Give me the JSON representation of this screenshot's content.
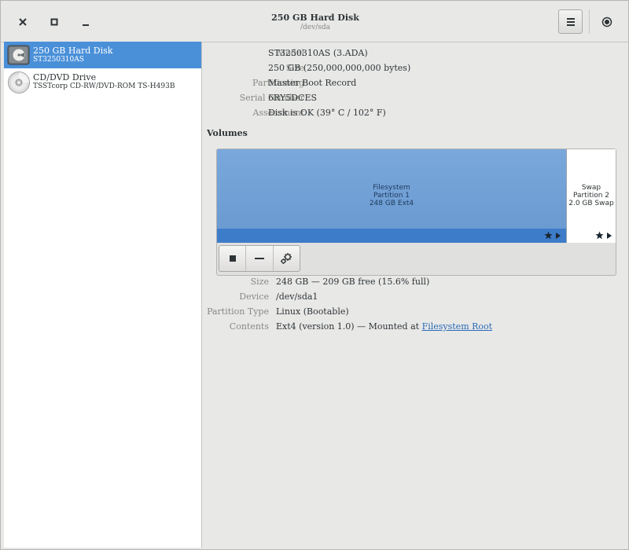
{
  "header": {
    "title": "250 GB Hard Disk",
    "subtitle": "/dev/sda",
    "close_icon": "close-icon",
    "maximize_icon": "maximize-icon",
    "minimize_icon": "minimize-icon",
    "menu_icon": "hamburger-menu-icon",
    "power_icon": "record-icon"
  },
  "sidebar": {
    "drives": [
      {
        "name": "250 GB Hard Disk",
        "desc": "ST3250310AS",
        "icon": "hard-disk-icon",
        "selected": true
      },
      {
        "name": "CD/DVD Drive",
        "desc": "TSSTcorp CD-RW/DVD-ROM TS-H493B",
        "icon": "optical-disc-icon",
        "selected": false
      }
    ]
  },
  "disk_info": {
    "model_label": "Model",
    "model_value": "ST3250310AS (3.ADA)",
    "size_label": "Size",
    "size_value": "250 GB (250,000,000,000 bytes)",
    "partitioning_label": "Partitioning",
    "partitioning_value": "Master Boot Record",
    "serial_label": "Serial Number",
    "serial_value": "6RY5DCES",
    "assessment_label": "Assessment",
    "assessment_value": "Disk is OK (39° C / 102° F)"
  },
  "volumes": {
    "heading": "Volumes",
    "partitions": [
      {
        "line1": "Filesystem",
        "line2": "Partition 1",
        "line3": "248 GB Ext4",
        "selected": true
      },
      {
        "line1": "Swap",
        "line2": "Partition 2",
        "line3": "2.0 GB Swap",
        "selected": false
      }
    ],
    "toolbar_icons": [
      "stop-icon",
      "minus-icon",
      "gears-icon"
    ]
  },
  "partition_info": {
    "size_label": "Size",
    "size_value": "248 GB — 209 GB free (15.6% full)",
    "device_label": "Device",
    "device_value": "/dev/sda1",
    "type_label": "Partition Type",
    "type_value": "Linux (Bootable)",
    "contents_label": "Contents",
    "contents_value": "Ext4 (version 1.0) — Mounted at ",
    "contents_link": "Filesystem Root"
  },
  "colors": {
    "selection": "#4a90d9",
    "partition_fill": "#6f9fd5",
    "link": "#2a6ab8"
  }
}
